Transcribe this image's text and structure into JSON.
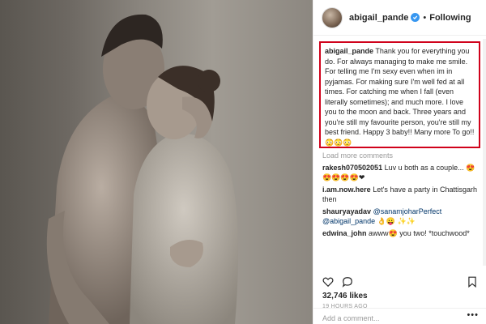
{
  "post": {
    "username": "abigail_pande",
    "separator": "•",
    "follow_status": "Following"
  },
  "caption": {
    "username": "abigail_pande",
    "text": "Thank you for everything you do. For always managing to make me smile. For telling me I'm sexy even when im in pyjamas. For making sure I'm well fed at all times. For catching me when I fall (even literally sometimes); and much more. I love you to the moon and back. Three years and you're still my favourite person, you're still my best friend. Happy 3 baby!! Many more To go!! 😳😳😳"
  },
  "load_more": "Load more comments",
  "comments": [
    {
      "user": "rakesh070502051",
      "text": "Luv u both as a couple... 😍😍😍😍😍❤"
    },
    {
      "user": "i.am.now.here",
      "text": "Let's have a party in Chattisgarh then"
    },
    {
      "user": "shauryayadav",
      "tag": "@sanamjoharPerfect",
      "tag2": "@abigail_pande",
      "text": "👌😛 ✨✨"
    },
    {
      "user": "edwina_john",
      "text": "awww😍 you two! *touchwood*"
    }
  ],
  "likes": "32,746 likes",
  "timestamp": "19 HOURS AGO",
  "add_comment": {
    "placeholder": "Add a comment...",
    "more": "•••"
  },
  "icons": [
    "heart-icon",
    "comment-icon",
    "bookmark-icon",
    "verified-icon"
  ],
  "colors": {
    "highlight_border": "#d0021b",
    "verified": "#3897f0",
    "muted": "#999999",
    "link": "#003569"
  }
}
